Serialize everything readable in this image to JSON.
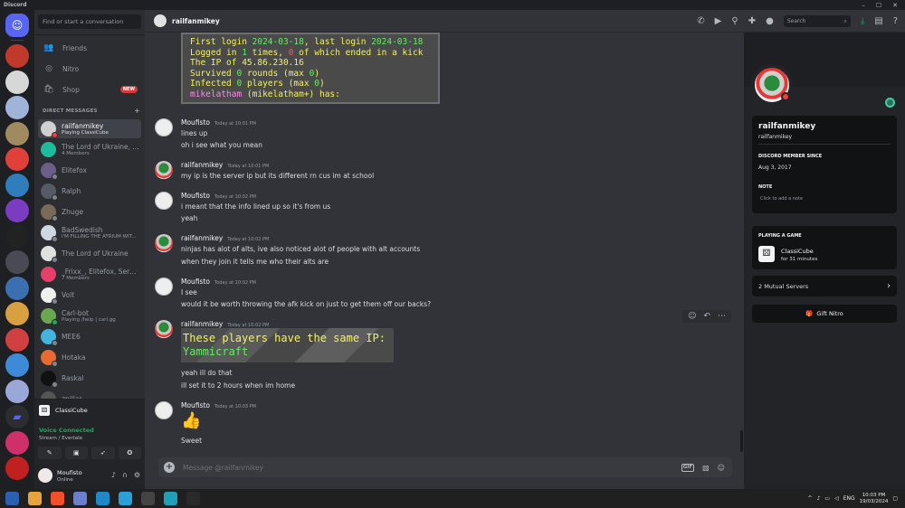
{
  "window": {
    "app_title": "Discord",
    "controls": [
      "–",
      "☐",
      "✕"
    ]
  },
  "servers": [
    {
      "name": "home",
      "color": "#5865f2"
    },
    {
      "name": "server-1",
      "color": "#c0392b"
    },
    {
      "name": "server-2",
      "color": "#d7d7d7"
    },
    {
      "name": "server-3",
      "color": "#9fb4d8"
    },
    {
      "name": "server-4",
      "color": "#a08a60"
    },
    {
      "name": "server-5",
      "color": "#e0403a"
    },
    {
      "name": "server-6",
      "color": "#2f7dbb"
    },
    {
      "name": "server-7",
      "color": "#7a3cc0"
    },
    {
      "name": "server-8",
      "color": "#222222"
    },
    {
      "name": "server-9",
      "color": "#4a4a55"
    },
    {
      "name": "server-10",
      "color": "#3c6fb0"
    },
    {
      "name": "server-11",
      "color": "#d8a040"
    },
    {
      "name": "server-12",
      "color": "#d04040"
    },
    {
      "name": "server-13",
      "color": "#3d8ad8"
    },
    {
      "name": "server-14",
      "color": "#9aa8d8"
    },
    {
      "name": "folder",
      "color": "#2b2d31"
    },
    {
      "name": "server-15",
      "color": "#d0306a"
    },
    {
      "name": "server-16",
      "color": "#c02020"
    }
  ],
  "sidebar": {
    "search_placeholder": "Find or start a conversation",
    "nav": [
      {
        "label": "Friends",
        "icon": "👥"
      },
      {
        "label": "Nitro",
        "icon": "◎"
      },
      {
        "label": "Shop",
        "icon": "🛍",
        "badge": "NEW"
      }
    ],
    "dm_header": "DIRECT MESSAGES",
    "dm_add": "+",
    "dms": [
      {
        "name": "railfanmikey",
        "sub": "Playing ClassiCube",
        "color": "#d0d0d0",
        "status": "#f23f43",
        "active": true
      },
      {
        "name": "The Lord of Ukraine, ...",
        "sub": "4 Members",
        "color": "#1abc9c",
        "status": ""
      },
      {
        "name": "Elitefox",
        "sub": "",
        "color": "#6b5f8a",
        "status": "#80848e"
      },
      {
        "name": "Ralph",
        "sub": "",
        "color": "#555a66",
        "status": "#80848e"
      },
      {
        "name": "Zhuge",
        "sub": "",
        "color": "#7a6a5a",
        "status": "#80848e"
      },
      {
        "name": "BadSwedish",
        "sub": "I'M FILLING THE ATRIUM WIT...",
        "color": "#cfd8e0",
        "status": "#80848e"
      },
      {
        "name": "The Lord of Ukraine",
        "sub": "",
        "color": "#e0e0e0",
        "status": "#80848e"
      },
      {
        "name": "_Frixx_, Elitefox, Sere...",
        "sub": "7 Members",
        "color": "#e83e6c",
        "status": ""
      },
      {
        "name": "Volt",
        "sub": "",
        "color": "#f0f0f0",
        "status": "#80848e"
      },
      {
        "name": "Carl-bot",
        "sub": "Playing /help | carl.gg",
        "color": "#6aa84f",
        "status": "#23a55a"
      },
      {
        "name": "MEE6",
        "sub": "",
        "color": "#45b3e0",
        "status": "#80848e"
      },
      {
        "name": "Hotaka",
        "sub": "",
        "color": "#e86a30",
        "status": "#80848e"
      },
      {
        "name": "Raskal",
        "sub": "",
        "color": "#111111",
        "status": "#80848e"
      },
      {
        "name": "zpillar",
        "sub": "",
        "color": "#555555",
        "status": "#80848e"
      }
    ]
  },
  "voice": {
    "game": "ClassiCube",
    "connected": "Voice Connected",
    "stream": "Stream / Evertale"
  },
  "user": {
    "name": "Moufisto",
    "status": "Online"
  },
  "chat": {
    "recipient": "railfanmikey",
    "search_placeholder": "Search",
    "mc_lines": [
      [
        {
          "t": "First login ",
          "c": "w"
        },
        {
          "t": "2024-03-18",
          "c": "g"
        },
        {
          "t": ", last login ",
          "c": "w"
        },
        {
          "t": "2024-03-18",
          "c": "g"
        }
      ],
      [
        {
          "t": "Logged in ",
          "c": "w"
        },
        {
          "t": "1",
          "c": "g"
        },
        {
          "t": " times, ",
          "c": "w"
        },
        {
          "t": "0",
          "c": "r"
        },
        {
          "t": " of which ended in a kick",
          "c": "w"
        }
      ],
      [
        {
          "t": "The IP of ",
          "c": "w"
        },
        {
          "t": "45.86.230.16",
          "c": "w"
        }
      ],
      [
        {
          "t": "Survived ",
          "c": "w"
        },
        {
          "t": "0",
          "c": "g"
        },
        {
          "t": " rounds (max ",
          "c": "w"
        },
        {
          "t": "0",
          "c": "g"
        },
        {
          "t": ")",
          "c": "w"
        }
      ],
      [
        {
          "t": "Infected ",
          "c": "w"
        },
        {
          "t": "0",
          "c": "g"
        },
        {
          "t": " players (max ",
          "c": "w"
        },
        {
          "t": "0",
          "c": "g"
        },
        {
          "t": ")",
          "c": "w"
        }
      ],
      [
        {
          "t": "mikelatham",
          "c": "p"
        },
        {
          "t": " (mikelatham+) has:",
          "c": "w"
        }
      ]
    ],
    "messages": [
      {
        "author": "Moufisto",
        "time": "Today at 10:01 PM",
        "lines": [
          "lines up",
          "oh i see what you mean"
        ]
      },
      {
        "author": "railfanmikey",
        "time": "Today at 10:01 PM",
        "lines": [
          "my ip is the server ip but its different rn cus im at school"
        ]
      },
      {
        "author": "Moufisto",
        "time": "Today at 10:02 PM",
        "lines": [
          "i meant that the info lined up so it's from us",
          "yeah"
        ]
      },
      {
        "author": "railfanmikey",
        "time": "Today at 10:02 PM",
        "lines": [
          "ninjas has alot of alts, ive also noticed alot of people with alt accounts",
          "when they join it tells me who their alts are"
        ]
      },
      {
        "author": "Moufisto",
        "time": "Today at 10:02 PM",
        "lines": [
          "I see",
          "would it be worth throwing the afk kick on just to get them off our backs?"
        ]
      },
      {
        "author": "railfanmikey",
        "time": "Today at 10:02 PM",
        "lines": [
          "yeah ill do that",
          "ill set it to 2 hours when im home"
        ]
      },
      {
        "author": "Moufisto",
        "time": "Today at 10:03 PM",
        "lines": [
          "Sweet"
        ]
      }
    ],
    "mc_image2": {
      "line1": "These players have the same IP:",
      "line2": "Yammicraft"
    },
    "composer_placeholder": "Message @railfanmikey",
    "gif_label": "GIF"
  },
  "profile": {
    "display_name": "railfanmikey",
    "username": "railfanmikey",
    "member_since_label": "DISCORD MEMBER SINCE",
    "member_since": "Aug 3, 2017",
    "note_label": "NOTE",
    "note_placeholder": "Click to add a note",
    "playing_label": "PLAYING A GAME",
    "game": "ClassiCube",
    "game_time": "for 31 minutes",
    "mutual_servers": "2 Mutual Servers",
    "gift_nitro": "Gift Nitro"
  },
  "taskbar": {
    "language": "ENG",
    "time": "10:03 PM",
    "date": "19/03/2024",
    "apps": [
      "#2b5fb0",
      "#e8a43a",
      "#f0502a",
      "#6a7fd0",
      "#1e88c8",
      "#2aa0d8",
      "#444444",
      "#1fa0b8",
      "#2a2a2a"
    ]
  }
}
